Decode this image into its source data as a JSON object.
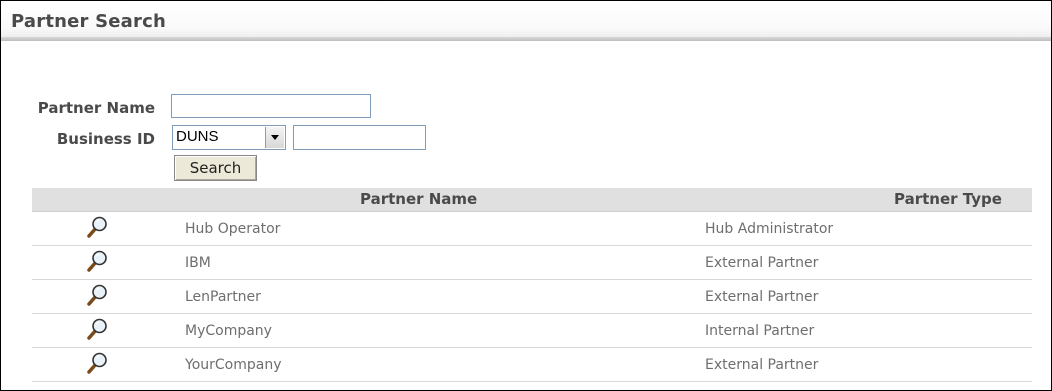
{
  "page": {
    "title": "Partner Search"
  },
  "form": {
    "partner_name_label": "Partner Name",
    "partner_name_value": "",
    "business_id_label": "Business ID",
    "business_id_type": "DUNS",
    "business_id_value": "",
    "search_label": "Search"
  },
  "table": {
    "columns": {
      "name": "Partner Name",
      "type": "Partner Type"
    },
    "rows": [
      {
        "name": "Hub Operator",
        "type": "Hub Administrator",
        "icon": "magnifier-icon"
      },
      {
        "name": "IBM",
        "type": "External Partner",
        "icon": "magnifier-icon"
      },
      {
        "name": "LenPartner",
        "type": "External Partner",
        "icon": "magnifier-icon"
      },
      {
        "name": "MyCompany",
        "type": "Internal Partner",
        "icon": "magnifier-icon"
      },
      {
        "name": "YourCompany",
        "type": "External Partner",
        "icon": "magnifier-icon"
      }
    ]
  },
  "colors": {
    "label": "#4a4a4a",
    "cell_text": "#6e6e6e",
    "header_bg": "#e0e0e0",
    "input_border": "#7f9db9"
  }
}
